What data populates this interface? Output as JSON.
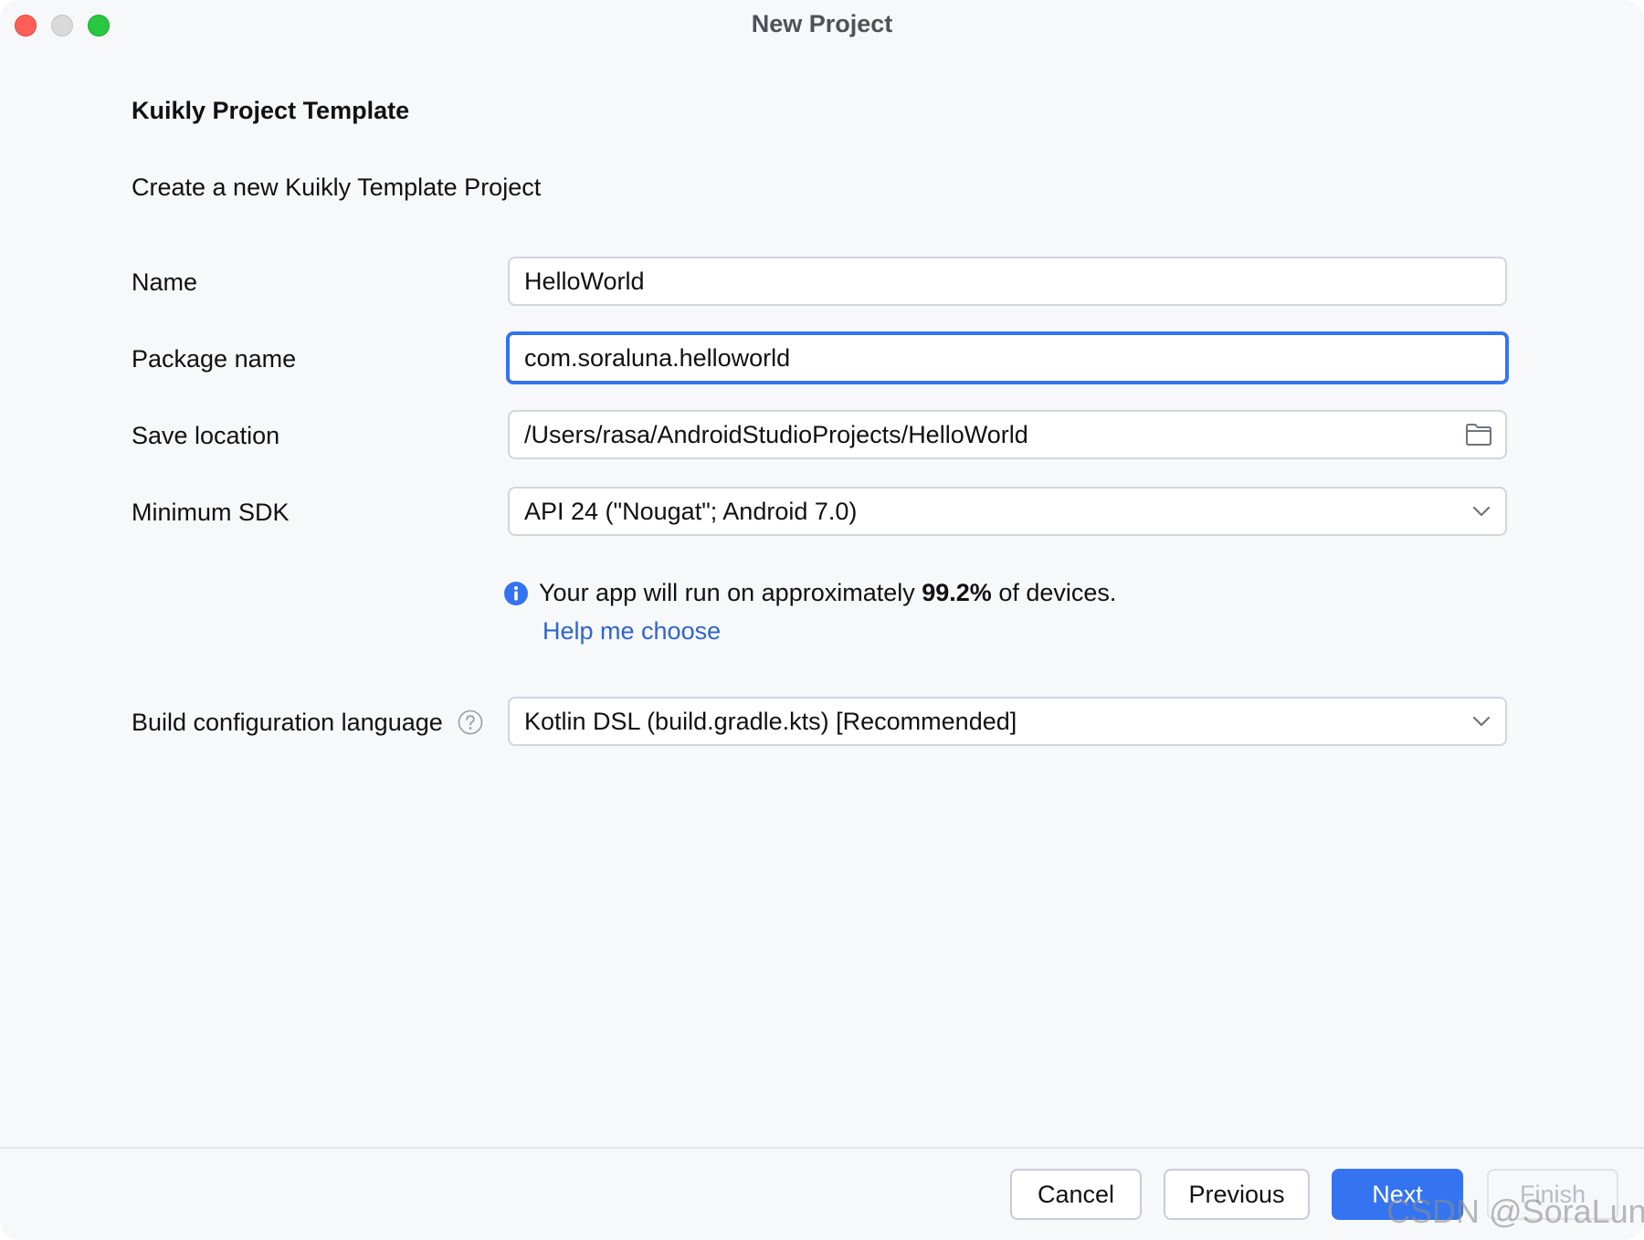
{
  "window": {
    "title": "New Project"
  },
  "form": {
    "heading": "Kuikly Project Template",
    "description": "Create a new Kuikly Template Project",
    "name": {
      "label": "Name",
      "value": "HelloWorld"
    },
    "package_name": {
      "label": "Package name",
      "value": "com.soraluna.helloworld"
    },
    "save_location": {
      "label": "Save location",
      "value": "/Users/rasa/AndroidStudioProjects/HelloWorld"
    },
    "minimum_sdk": {
      "label": "Minimum SDK",
      "value": "API 24 (\"Nougat\"; Android 7.0)"
    },
    "sdk_info": {
      "prefix": "Your app will run on approximately ",
      "percent": "99.2%",
      "suffix": " of devices.",
      "help_link": "Help me choose"
    },
    "build_config": {
      "label": "Build configuration language",
      "value": "Kotlin DSL (build.gradle.kts) [Recommended]"
    }
  },
  "footer": {
    "cancel_label": "Cancel",
    "previous_label": "Previous",
    "next_label": "Next",
    "finish_label": "Finish"
  },
  "watermark": "CSDN @SoraLuna",
  "colors": {
    "accent": "#3574f0",
    "link": "#2f65ca",
    "background": "#f7f8fa"
  }
}
